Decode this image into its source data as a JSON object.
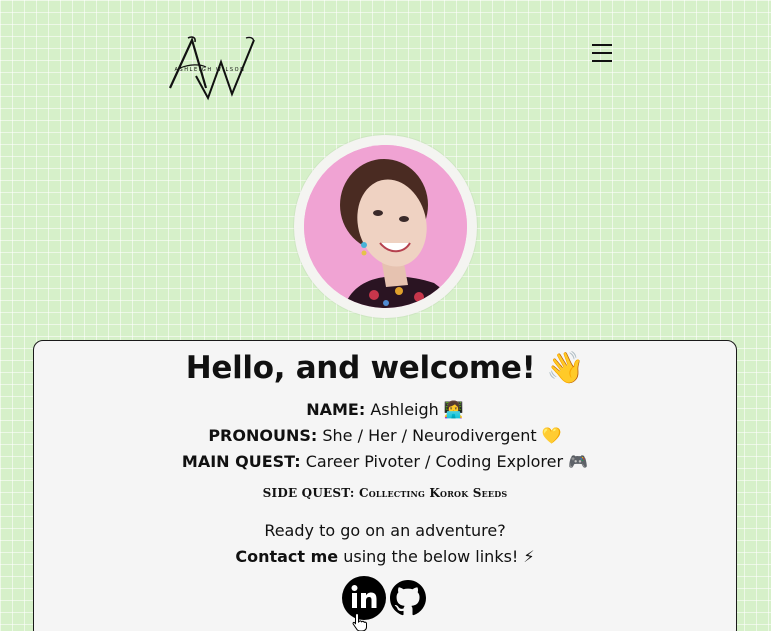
{
  "header": {
    "logo_monogram": "AW",
    "logo_subtitle": "ASHLEIGH WILSON",
    "menu_icon": "hamburger-menu-icon"
  },
  "profile": {
    "avatar_alt": "Ashleigh"
  },
  "card": {
    "greeting": "Hello, and welcome! 👋",
    "name_label": "NAME:",
    "name_value": "Ashleigh 👩‍💻",
    "pronouns_label": "PRONOUNS:",
    "pronouns_value": "She / Her / Neurodivergent 💛",
    "quest_label": "MAIN QUEST:",
    "quest_value": "Career Pivoter / Coding Explorer 🎮",
    "side_quest_label": "SIDE QUEST:",
    "side_quest_value": "Collecting Korok Seeds",
    "ready_text": "Ready to go on an adventure?",
    "contact_bold": "Contact me",
    "contact_rest": "using the below links! ⚡"
  },
  "socials": [
    {
      "icon": "linkedin-icon"
    },
    {
      "icon": "github-icon"
    }
  ],
  "colors": {
    "background": "#d6f0c9",
    "card": "#f5f5f5",
    "avatar_bg": "#f0a3d3",
    "text": "#111111"
  }
}
